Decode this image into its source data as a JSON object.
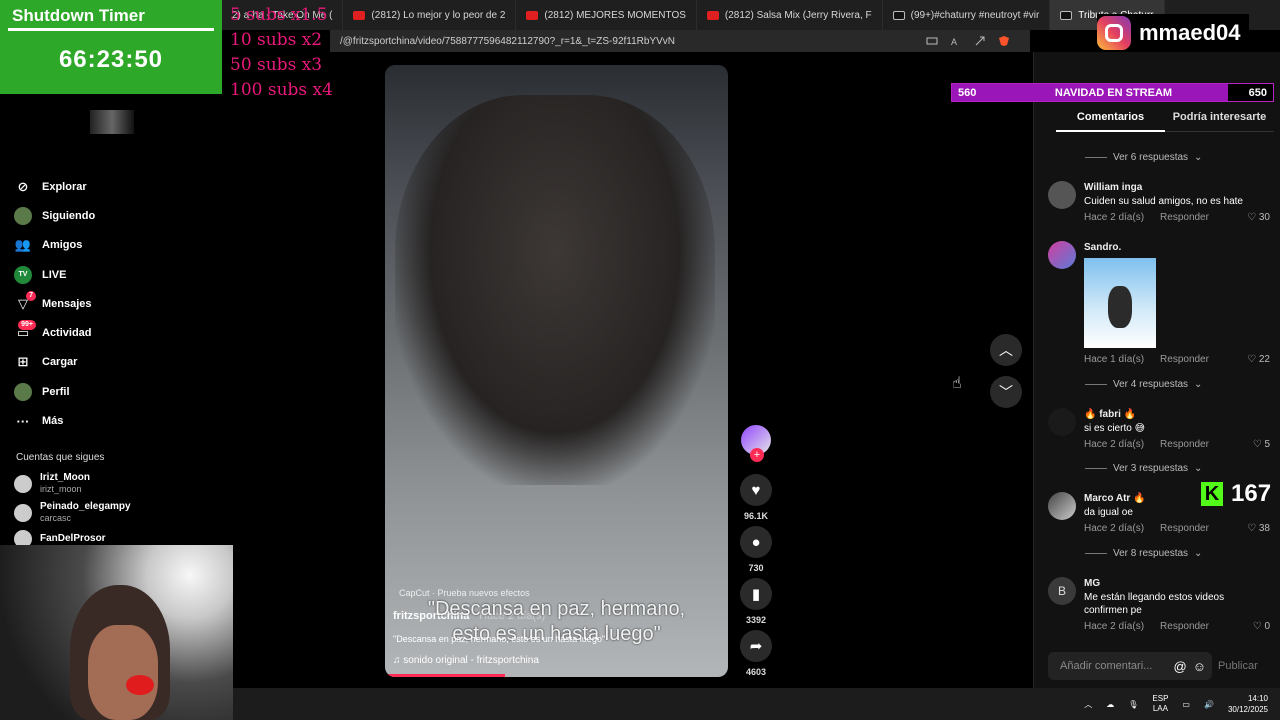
{
  "browser": {
    "tabs": [
      {
        "title": "2) a-ha - Take On Me (",
        "icon": "youtube-icon"
      },
      {
        "title": "(2812) Lo mejor y lo peor de 2",
        "icon": "youtube-icon"
      },
      {
        "title": "(2812) MEJORES MOMENTOS",
        "icon": "youtube-icon"
      },
      {
        "title": "(2812) Salsa Mix (Jerry Rivera, F",
        "icon": "youtube-icon"
      },
      {
        "title": "(99+)#chaturry #neutroyt #vir",
        "icon": "tiktok-icon"
      },
      {
        "title": "Tributo a Chaturr",
        "icon": "tiktok-icon"
      }
    ],
    "url": "/@fritzsportchina/video/7588777596482112790?_r=1&_t=ZS-92f11RbYVvN"
  },
  "timer": {
    "title": "Shutdown Timer",
    "time": "66:23:50"
  },
  "subs_overlay": [
    "5 subs x1.5",
    "10 subs x2",
    "50 subs x3",
    "100 subs x4"
  ],
  "sidebar": {
    "items": [
      {
        "label": "Explorar",
        "icon": "compass-icon"
      },
      {
        "label": "Siguiendo",
        "icon": "following-avatar-icon"
      },
      {
        "label": "Amigos",
        "icon": "friends-icon"
      },
      {
        "label": "LIVE",
        "icon": "live-icon"
      },
      {
        "label": "Mensajes",
        "icon": "messages-icon",
        "badge": "7"
      },
      {
        "label": "Actividad",
        "icon": "activity-icon",
        "badge": "99+"
      },
      {
        "label": "Cargar",
        "icon": "upload-icon"
      },
      {
        "label": "Perfil",
        "icon": "profile-icon"
      },
      {
        "label": "Más",
        "icon": "more-icon"
      }
    ],
    "following_header": "Cuentas que sigues",
    "following": [
      {
        "name": "Irizt_Moon",
        "handle": "irizt_moon"
      },
      {
        "name": "Peinado_elegampy",
        "handle": "carcasc"
      },
      {
        "name": "FanDelProsor",
        "handle": ""
      }
    ]
  },
  "video": {
    "capcut": "CapCut · Prueba nuevos efectos",
    "author": "fritzsportchina",
    "ago": " · Hace 2 día(s)",
    "caption_overlay_1": "\"Descansa en paz, hermano,",
    "caption_overlay_2": "esto es un hasta luego\"",
    "description": "\"Descansa en paz, hermano, esto es un hasta luego\"",
    "sound": "sonido original - fritzsportchina",
    "progress": 0.35
  },
  "actions": {
    "likes": "96.1K",
    "comments": "730",
    "saves": "3392",
    "shares": "4603"
  },
  "overlay": {
    "instagram_handle": "mmaed04",
    "goal_current": "560",
    "goal_label": "NAVIDAD EN STREAM",
    "goal_target": "650",
    "goal_fraction": 0.86,
    "kick_count": "167"
  },
  "comments_panel": {
    "tabs": [
      "Comentarios",
      "Podría interesarte"
    ],
    "replies": [
      "Ver 6 respuestas",
      "Ver 4 respuestas",
      "Ver 3 respuestas",
      "Ver 8 respuestas"
    ],
    "reply_label": "Responder",
    "comments": [
      {
        "name": "William inga",
        "text": "Cuiden su salud amigos, no es hate",
        "time": "Hace 2 día(s)",
        "likes": "30"
      },
      {
        "name": "Sandro.",
        "text": "",
        "time": "Hace 1 día(s)",
        "likes": "22"
      },
      {
        "name": "🔥 fabri 🔥",
        "text": "si es cierto 😅",
        "time": "Hace 2 día(s)",
        "likes": "5"
      },
      {
        "name": "Marco Atr 🔥",
        "text": "da igual oe",
        "time": "Hace 2 día(s)",
        "likes": "38"
      },
      {
        "name": "MG",
        "text": "Me están llegando estos videos confirmen pe",
        "time": "Hace 2 día(s)",
        "likes": "0",
        "initial": "B"
      }
    ],
    "add_placeholder": "Añadir comentari...",
    "publish": "Publicar"
  },
  "taskbar": {
    "lang": "ESP",
    "lang2": "LAA",
    "time": "14:10",
    "date": "30/12/2025"
  }
}
